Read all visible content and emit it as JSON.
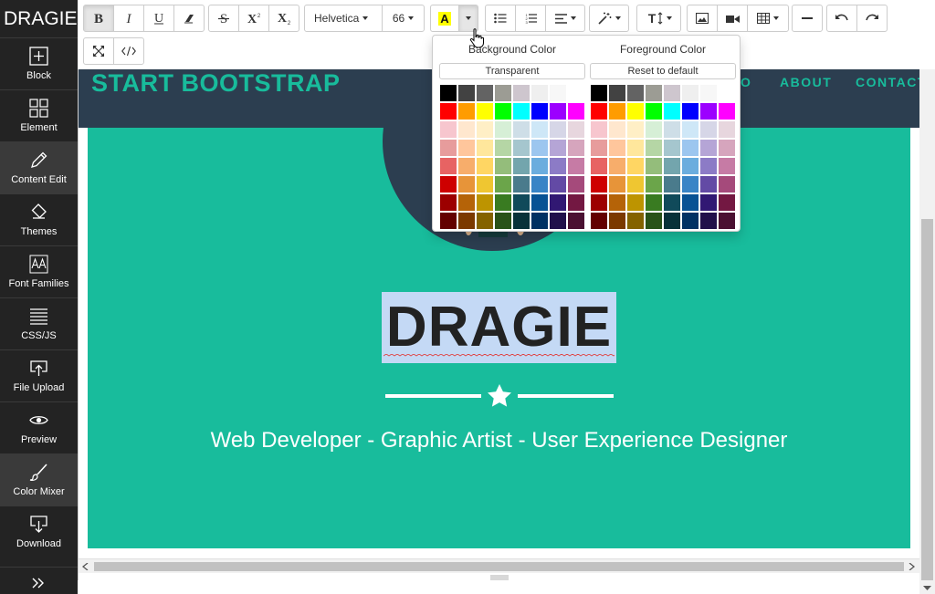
{
  "sidebar": {
    "logo": "DRAGIE",
    "items": [
      {
        "label": "Block",
        "icon": "plus-square-icon"
      },
      {
        "label": "Element",
        "icon": "grid-icon"
      },
      {
        "label": "Content Edit",
        "icon": "pencil-icon"
      },
      {
        "label": "Themes",
        "icon": "paint-bucket-icon"
      },
      {
        "label": "Font Families",
        "icon": "font-aa-icon"
      },
      {
        "label": "CSS/JS",
        "icon": "lines-icon"
      },
      {
        "label": "File Upload",
        "icon": "upload-icon"
      },
      {
        "label": "Preview",
        "icon": "eye-icon"
      },
      {
        "label": "Color Mixer",
        "icon": "brush-icon"
      },
      {
        "label": "Download",
        "icon": "download-icon"
      }
    ],
    "active": [
      "Content Edit",
      "Color Mixer"
    ],
    "more_icon": "double-chevron-right-icon"
  },
  "toolbar": {
    "font_name": "Helvetica",
    "font_size": "66",
    "color_button_letter": "A",
    "color_button_highlight": "#ffff00"
  },
  "palette": {
    "bg_title": "Background Color",
    "fg_title": "Foreground Color",
    "transparent_label": "Transparent",
    "reset_label": "Reset to default",
    "colors": [
      [
        "#000000",
        "#424242",
        "#636363",
        "#9c9c94",
        "#cec6ce",
        "#efefef",
        "#f7f7f7",
        "#ffffff"
      ],
      [
        "#ff0000",
        "#ff9c00",
        "#ffff00",
        "#00ff00",
        "#00ffff",
        "#0000ff",
        "#9c00ff",
        "#ff00ff"
      ],
      [
        "#f7c6ce",
        "#ffe7ce",
        "#ffefc6",
        "#d6efd6",
        "#cedee7",
        "#cee7f7",
        "#d6d6e7",
        "#e7d6de"
      ],
      [
        "#e79c9c",
        "#ffc69c",
        "#ffe79c",
        "#b5d6a5",
        "#a5c6ce",
        "#9cc6ef",
        "#b5a5d6",
        "#d6a5bd"
      ],
      [
        "#e76363",
        "#f7ad6b",
        "#ffd663",
        "#94bd7b",
        "#73a5ad",
        "#6badde",
        "#8c7bc6",
        "#c67ba5"
      ],
      [
        "#ce0000",
        "#e79439",
        "#efc631",
        "#6ba54a",
        "#4a7b8c",
        "#3984c6",
        "#634aa5",
        "#a54a7b"
      ],
      [
        "#9c0000",
        "#b56308",
        "#bd9400",
        "#397b21",
        "#104a5a",
        "#085294",
        "#311873",
        "#731842"
      ],
      [
        "#630000",
        "#7b3900",
        "#846300",
        "#295218",
        "#083139",
        "#003163",
        "#21104a",
        "#4a1031"
      ]
    ]
  },
  "page": {
    "brand": "START BOOTSTRAP",
    "nav_links": [
      "O",
      "ABOUT",
      "CONTACT"
    ],
    "name": "DRAGIE",
    "tagline": "Web Developer - Graphic Artist - User Experience Designer",
    "colors": {
      "navbar": "#2c3e50",
      "header": "#18bc9c",
      "accent": "#18bc9c"
    }
  }
}
